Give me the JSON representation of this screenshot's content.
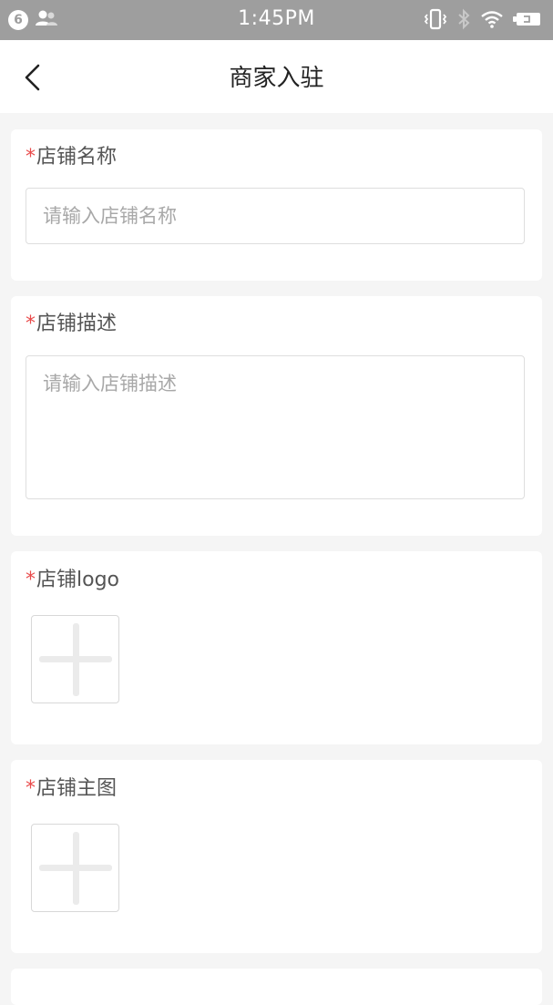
{
  "status_bar": {
    "notification_count": "6",
    "time": "1:45PM"
  },
  "nav": {
    "title": "商家入驻"
  },
  "form": {
    "required_mark": "*",
    "shop_name": {
      "label": "店铺名称",
      "placeholder": "请输入店铺名称",
      "value": ""
    },
    "shop_description": {
      "label": "店铺描述",
      "placeholder": "请输入店铺描述",
      "value": ""
    },
    "shop_logo": {
      "label": "店铺logo"
    },
    "shop_main_image": {
      "label": "店铺主图"
    }
  }
}
